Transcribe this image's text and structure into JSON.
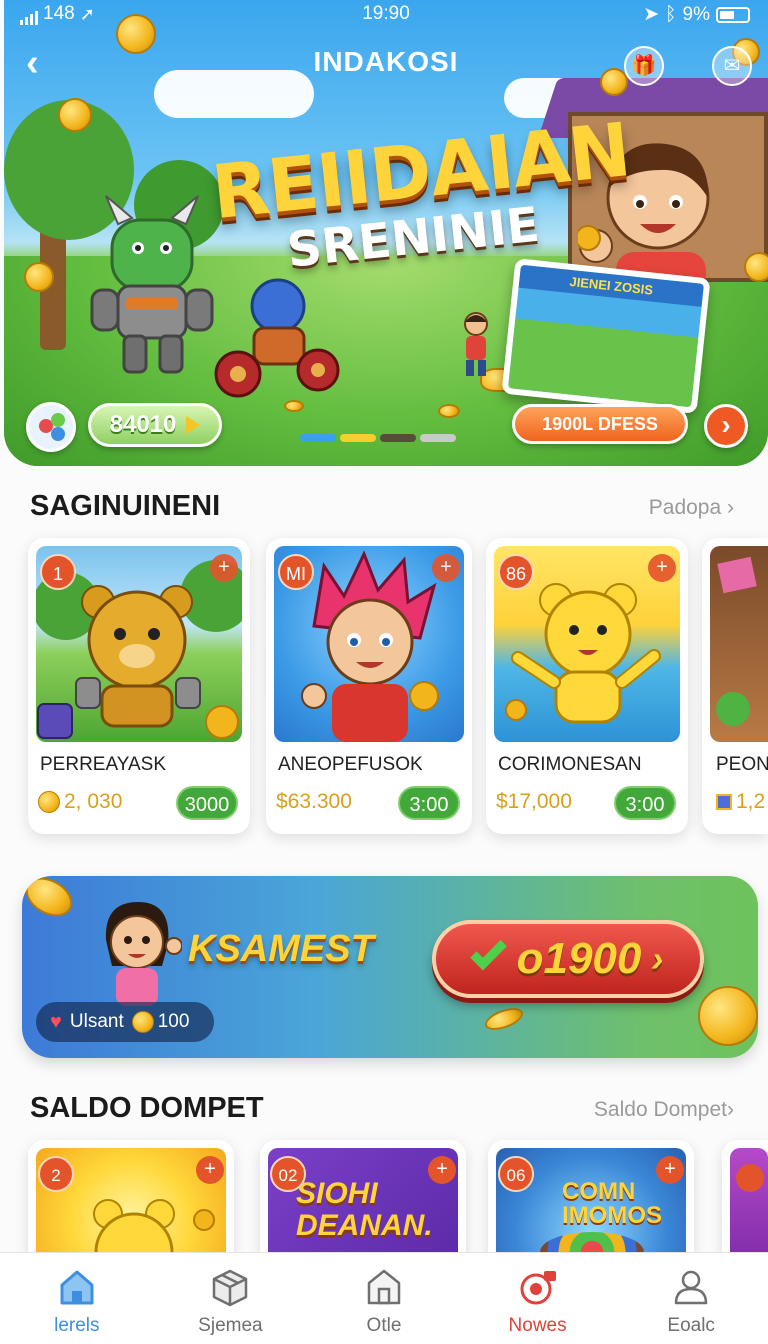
{
  "status_bar": {
    "signal": "148",
    "time": "19:90",
    "battery": "9%"
  },
  "hero": {
    "title": "INDAKOSI",
    "headline_1": "REIIDAIAN",
    "headline_2": "SRENINIE",
    "screen_label": "JIENEI ZOSIS",
    "left_pill": "84010",
    "right_pill": "1900L DFESS",
    "dot_colors": [
      "#3aa0ec",
      "#f5cf2b",
      "#5a4a3c",
      "#c9c9c9"
    ]
  },
  "section1": {
    "title": "SAGINUINENI",
    "link": "Padopa",
    "cards": [
      {
        "num": "1",
        "name": "PERREAYASK",
        "price": "2, 030",
        "button": "3000"
      },
      {
        "num": "MI",
        "name": "ANEOPEFUSOK",
        "price": "$63.300",
        "button": "3:00"
      },
      {
        "num": "86",
        "name": "CORIMONESAN",
        "price": "$17,000",
        "button": "3:00"
      },
      {
        "num": "",
        "name": "PEONI",
        "price": "1,2",
        "button": ""
      }
    ]
  },
  "promo": {
    "title": "KSAMEST",
    "button_value": "o1900",
    "user_label": "Ulsant",
    "user_coins": "100"
  },
  "section2": {
    "title": "SALDO DOMPET",
    "link": "Saldo Dompet",
    "cards": [
      {
        "num": "2",
        "art_text": ""
      },
      {
        "num": "02",
        "art_text": "SIOHI DEANAN."
      },
      {
        "num": "06",
        "art_text": "COMN IMOMOS"
      }
    ]
  },
  "nav": {
    "items": [
      {
        "label": "lerels",
        "icon": "home-icon",
        "color": "#3f8fe0"
      },
      {
        "label": "Sjemea",
        "icon": "box-icon",
        "color": "#6f6f6f"
      },
      {
        "label": "Otle",
        "icon": "building-icon",
        "color": "#6f6f6f"
      },
      {
        "label": "Nowes",
        "icon": "target-icon",
        "color": "#e0423b"
      },
      {
        "label": "Eoalc",
        "icon": "user-icon",
        "color": "#6f6f6f"
      }
    ]
  }
}
